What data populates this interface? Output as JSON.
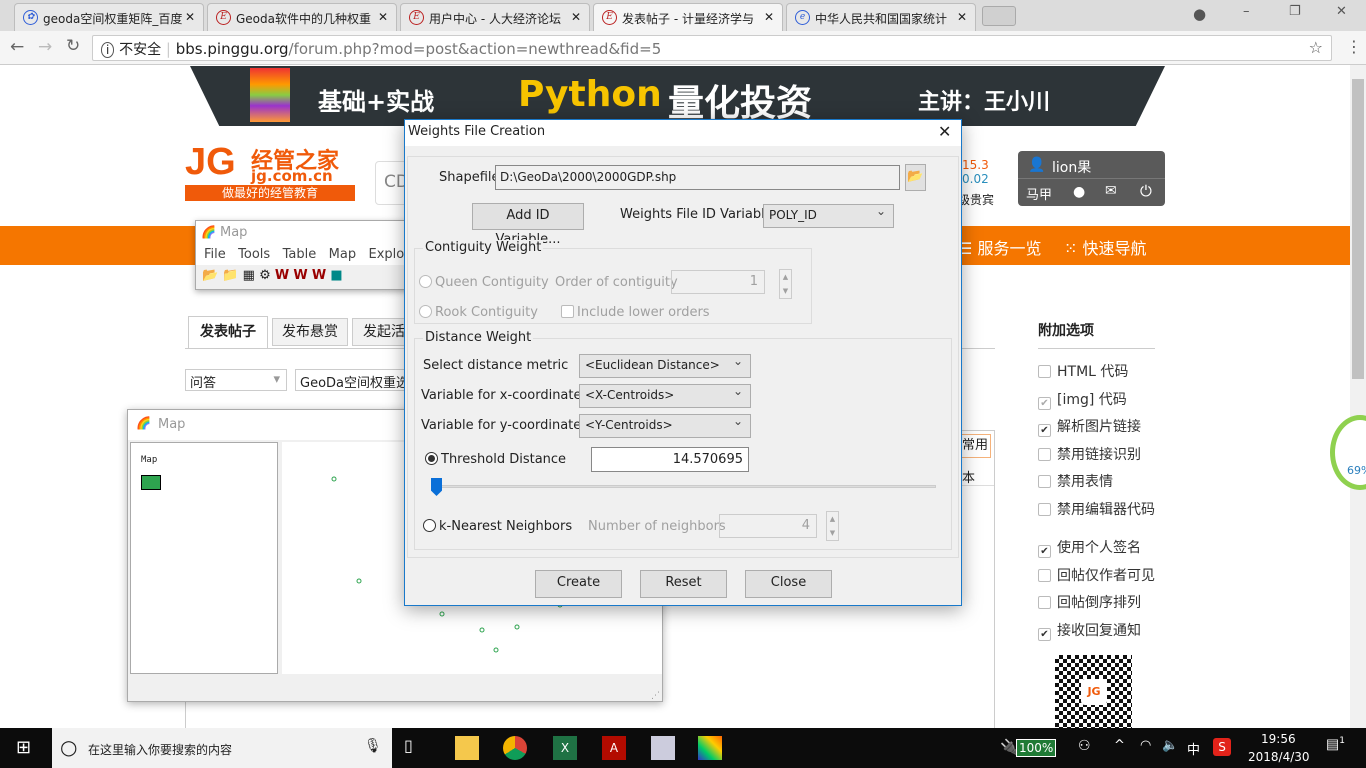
{
  "browser": {
    "tabs": [
      {
        "label": "geoda空间权重矩阵_百度",
        "active": false
      },
      {
        "label": "Geoda软件中的几种权重",
        "active": false
      },
      {
        "label": "用户中心 - 人大经济论坛",
        "active": false
      },
      {
        "label": "发表帖子 - 计量经济学与",
        "active": true
      },
      {
        "label": "中华人民共和国国家统计",
        "active": false
      }
    ],
    "security": "不安全",
    "url_host": "bbs.pinggu.org",
    "url_path": "/forum.php?mod=post&action=newthread&fid=5"
  },
  "banner": {
    "left": "基础+实战",
    "python": "Python",
    "title": "量化投资",
    "lecturer": "主讲：王小川"
  },
  "site": {
    "logo_name": "经管之家",
    "logo_domain": "jg.com.cn",
    "logo_slogan": "做最好的经管教育",
    "search_value": "CD",
    "stat1": "15.3",
    "stat2": "0.02",
    "stat3": "级贵宾",
    "user": "lion果",
    "user_btn": "马甲",
    "nav": [
      "服务一览",
      "快速导航"
    ],
    "post_tabs": [
      "发表帖子",
      "发布悬赏",
      "发起活"
    ],
    "category": "问答",
    "title_value": "GeoDa空间权重选择",
    "editor_labels": [
      "常用",
      "本"
    ]
  },
  "sidebar": {
    "heading": "附加选项",
    "options": [
      {
        "label": "HTML 代码",
        "checked": false,
        "disabled": true
      },
      {
        "label": "[img] 代码",
        "checked": true,
        "disabled": true
      },
      {
        "label": "解析图片链接",
        "checked": true
      },
      {
        "label": "禁用链接识别",
        "checked": false
      },
      {
        "label": "禁用表情",
        "checked": false
      },
      {
        "label": "禁用编辑器代码",
        "checked": false
      },
      {
        "label": "使用个人签名",
        "checked": true
      },
      {
        "label": "回帖仅作者可见",
        "checked": false
      },
      {
        "label": "回帖倒序排列",
        "checked": false
      },
      {
        "label": "接收回复通知",
        "checked": true
      }
    ]
  },
  "float_widget": {
    "percent": "69%"
  },
  "map_small": {
    "title": "Map",
    "menu": [
      "File",
      "Tools",
      "Table",
      "Map",
      "Explor"
    ]
  },
  "map_large": {
    "title": "Map",
    "legend_title": "Map",
    "legend_color": "#2ea44f"
  },
  "dialog": {
    "title": "Weights File Creation",
    "shapefile_label": "Shapefile",
    "shapefile_value": "D:\\GeoDa\\2000\\2000GDP.shp",
    "add_id_button": "Add ID Variable...",
    "id_var_label": "Weights File ID Variable",
    "id_var_value": "POLY_ID",
    "contiguity": {
      "legend": "Contiguity Weight",
      "queen": "Queen Contiguity",
      "rook": "Rook Contiguity",
      "order_label": "Order of contiguity",
      "order_value": "1",
      "include_lower": "Include lower orders"
    },
    "distance": {
      "legend": "Distance Weight",
      "metric_label": "Select distance metric",
      "metric_value": "<Euclidean Distance>",
      "x_label": "Variable for x-coordinates",
      "x_value": "<X-Centroids>",
      "y_label": "Variable for y-coordinates",
      "y_value": "<Y-Centroids>",
      "threshold_label": "Threshold Distance",
      "threshold_value": "14.570695",
      "slider_percent": 0,
      "knn_label": "k-Nearest Neighbors",
      "neighbors_label": "Number of neighbors",
      "neighbors_value": "4",
      "selected": "threshold"
    },
    "buttons": [
      "Create",
      "Reset",
      "Close"
    ]
  },
  "taskbar": {
    "search_placeholder": "在这里输入你要搜索的内容",
    "battery": "100%",
    "ime": "中",
    "time": "19:56",
    "date": "2018/4/30",
    "notifications": "1"
  }
}
